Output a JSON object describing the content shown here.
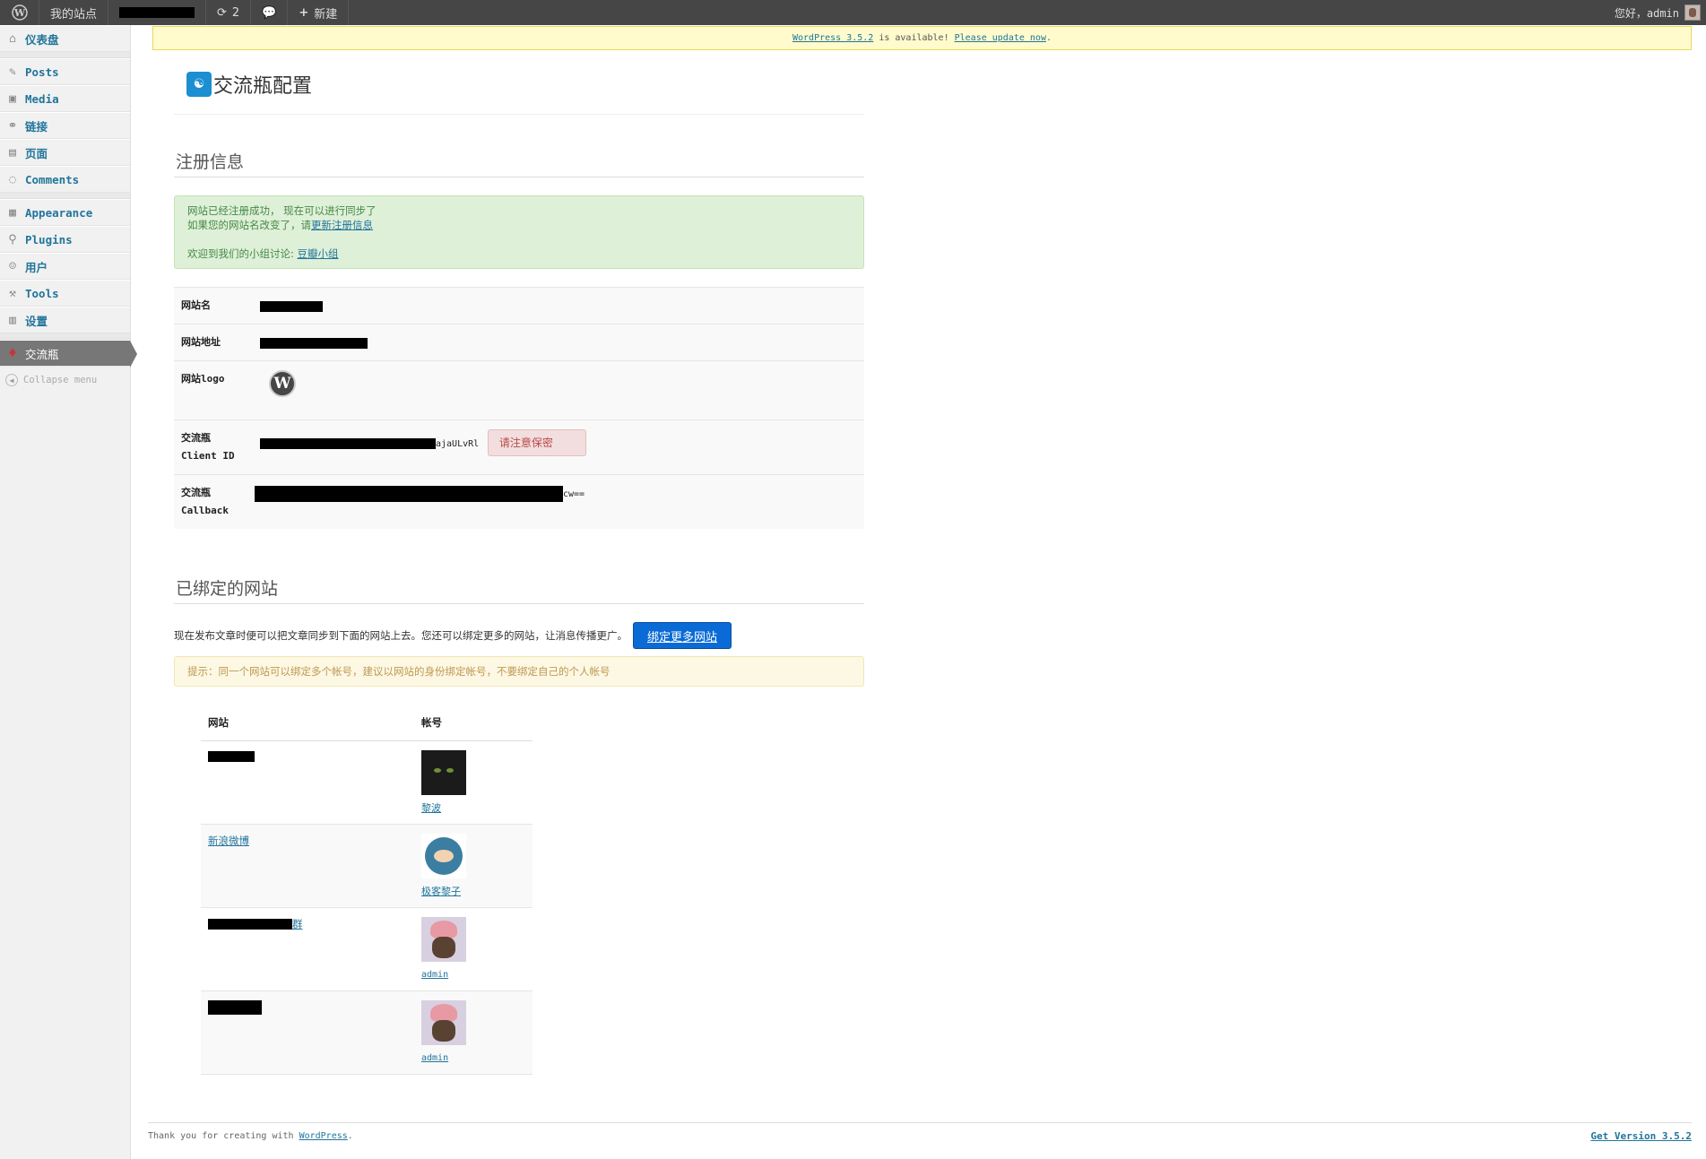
{
  "adminbar": {
    "my_site": "我的站点",
    "updates_count": "2",
    "new_label": "新建",
    "greeting": "您好，admin"
  },
  "sidebar": {
    "items": [
      {
        "label": "仪表盘",
        "icon": "dashboard-icon"
      },
      {
        "label": "Posts",
        "icon": "pin-icon"
      },
      {
        "label": "Media",
        "icon": "media-icon"
      },
      {
        "label": "链接",
        "icon": "link-icon"
      },
      {
        "label": "页面",
        "icon": "page-icon"
      },
      {
        "label": "Comments",
        "icon": "comment-icon"
      },
      {
        "label": "Appearance",
        "icon": "appearance-icon"
      },
      {
        "label": "Plugins",
        "icon": "plugin-icon"
      },
      {
        "label": "用户",
        "icon": "users-icon"
      },
      {
        "label": "Tools",
        "icon": "tools-icon"
      },
      {
        "label": "设置",
        "icon": "settings-icon"
      },
      {
        "label": "交流瓶",
        "icon": "bottle-icon"
      }
    ],
    "collapse": "Collapse menu"
  },
  "notice": {
    "version_link": "WordPress 3.5.2",
    "mid": " is available! ",
    "update_link": "Please update now",
    "end": "."
  },
  "page": {
    "title": "交流瓶配置"
  },
  "register": {
    "heading": "注册信息",
    "success_line1": "网站已经注册成功， 现在可以进行同步了",
    "success_line2_pre": "如果您的网站名改变了，请",
    "success_line2_link": "更新注册信息",
    "success_line3_pre": "欢迎到我们的小组讨论: ",
    "success_line3_link": "豆瓣小组",
    "rows": {
      "site_name_label": "网站名",
      "site_url_label": "网站地址",
      "site_logo_label": "网站logo",
      "client_id_label_1": "交流瓶",
      "client_id_label_2": "Client ID",
      "client_id_suffix": "ajaULvRl",
      "client_id_warning": "请注意保密",
      "callback_label_1": "交流瓶",
      "callback_label_2": "Callback",
      "callback_suffix": "cw=="
    }
  },
  "bound": {
    "heading": "已绑定的网站",
    "description": "现在发布文章时便可以把文章同步到下面的网站上去。您还可以绑定更多的网站，让消息传播更广。",
    "bind_button": "绑定更多网站",
    "tip": "提示：同一个网站可以绑定多个帐号，建议以网站的身份绑定帐号，不要绑定自己的个人帐号",
    "col_site": "网站",
    "col_account": "帐号",
    "rows": [
      {
        "site": "",
        "account": "黎波",
        "avatar": "cat"
      },
      {
        "site": "新浪微博",
        "account": "极客黎子",
        "avatar": "robot"
      },
      {
        "site": "群",
        "account": "admin",
        "avatar": "monkey"
      },
      {
        "site": "",
        "account": "admin",
        "avatar": "monkey"
      }
    ]
  },
  "footer": {
    "thanks_pre": "Thank you for creating with ",
    "thanks_link": "WordPress",
    "thanks_end": ".",
    "version": "Get Version 3.5.2"
  }
}
